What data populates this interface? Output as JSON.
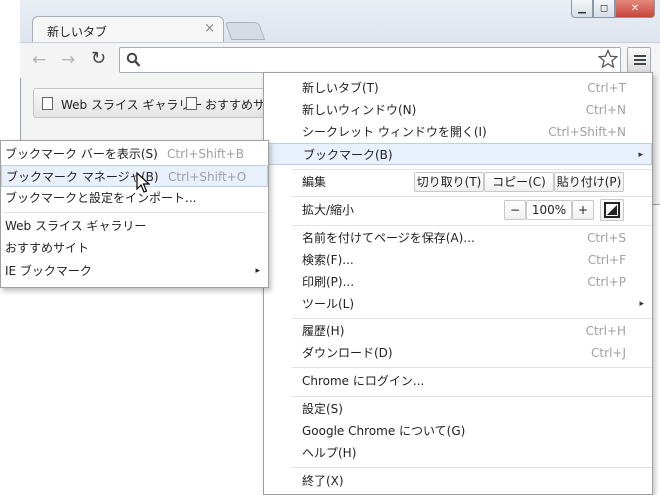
{
  "browser": {
    "tab_title": "新しいタブ",
    "tab_close": "×",
    "window_buttons": {
      "minimize": "▁",
      "maximize": "◻",
      "close": "✕"
    },
    "nav": {
      "back": "←",
      "forward": "→",
      "reload": "↻"
    },
    "bookmarks_bar": [
      {
        "label": "Web スライス ギャラリー"
      },
      {
        "label": "おすすめサイ"
      }
    ]
  },
  "main_menu": {
    "items": [
      {
        "label": "新しいタブ(T)",
        "shortcut": "Ctrl+T"
      },
      {
        "label": "新しいウィンドウ(N)",
        "shortcut": "Ctrl+N"
      },
      {
        "label": "シークレット ウィンドウを開く(I)",
        "shortcut": "Ctrl+Shift+N"
      },
      {
        "label": "ブックマーク(B)",
        "arrow": "▸"
      }
    ],
    "edit": {
      "label": "編集",
      "cut": "切り取り(T)",
      "copy": "コピー(C)",
      "paste": "貼り付け(P)"
    },
    "zoom": {
      "label": "拡大/縮小",
      "minus": "−",
      "value": "100%",
      "plus": "+"
    },
    "items2": [
      {
        "label": "名前を付けてページを保存(A)...",
        "shortcut": "Ctrl+S"
      },
      {
        "label": "検索(F)...",
        "shortcut": "Ctrl+F"
      },
      {
        "label": "印刷(P)...",
        "shortcut": "Ctrl+P"
      },
      {
        "label": "ツール(L)",
        "arrow": "▸"
      }
    ],
    "items3": [
      {
        "label": "履歴(H)",
        "shortcut": "Ctrl+H"
      },
      {
        "label": "ダウンロード(D)",
        "shortcut": "Ctrl+J"
      }
    ],
    "signin": {
      "label": "Chrome にログイン..."
    },
    "items4": [
      {
        "label": "設定(S)"
      },
      {
        "label": "Google Chrome について(G)"
      },
      {
        "label": "ヘルプ(H)"
      }
    ],
    "exit": {
      "label": "終了(X)"
    }
  },
  "bookmark_submenu": {
    "items": [
      {
        "label": "ブックマーク バーを表示(S)",
        "shortcut": "Ctrl+Shift+B"
      },
      {
        "label": "ブックマーク マネージャ(B)",
        "shortcut": "Ctrl+Shift+O"
      },
      {
        "label": "ブックマークと設定をインポート..."
      }
    ],
    "items2": [
      {
        "label": "Web スライス ギャラリー"
      },
      {
        "label": "おすすめサイト"
      },
      {
        "label": "IE ブックマーク",
        "arrow": "▸"
      }
    ]
  }
}
